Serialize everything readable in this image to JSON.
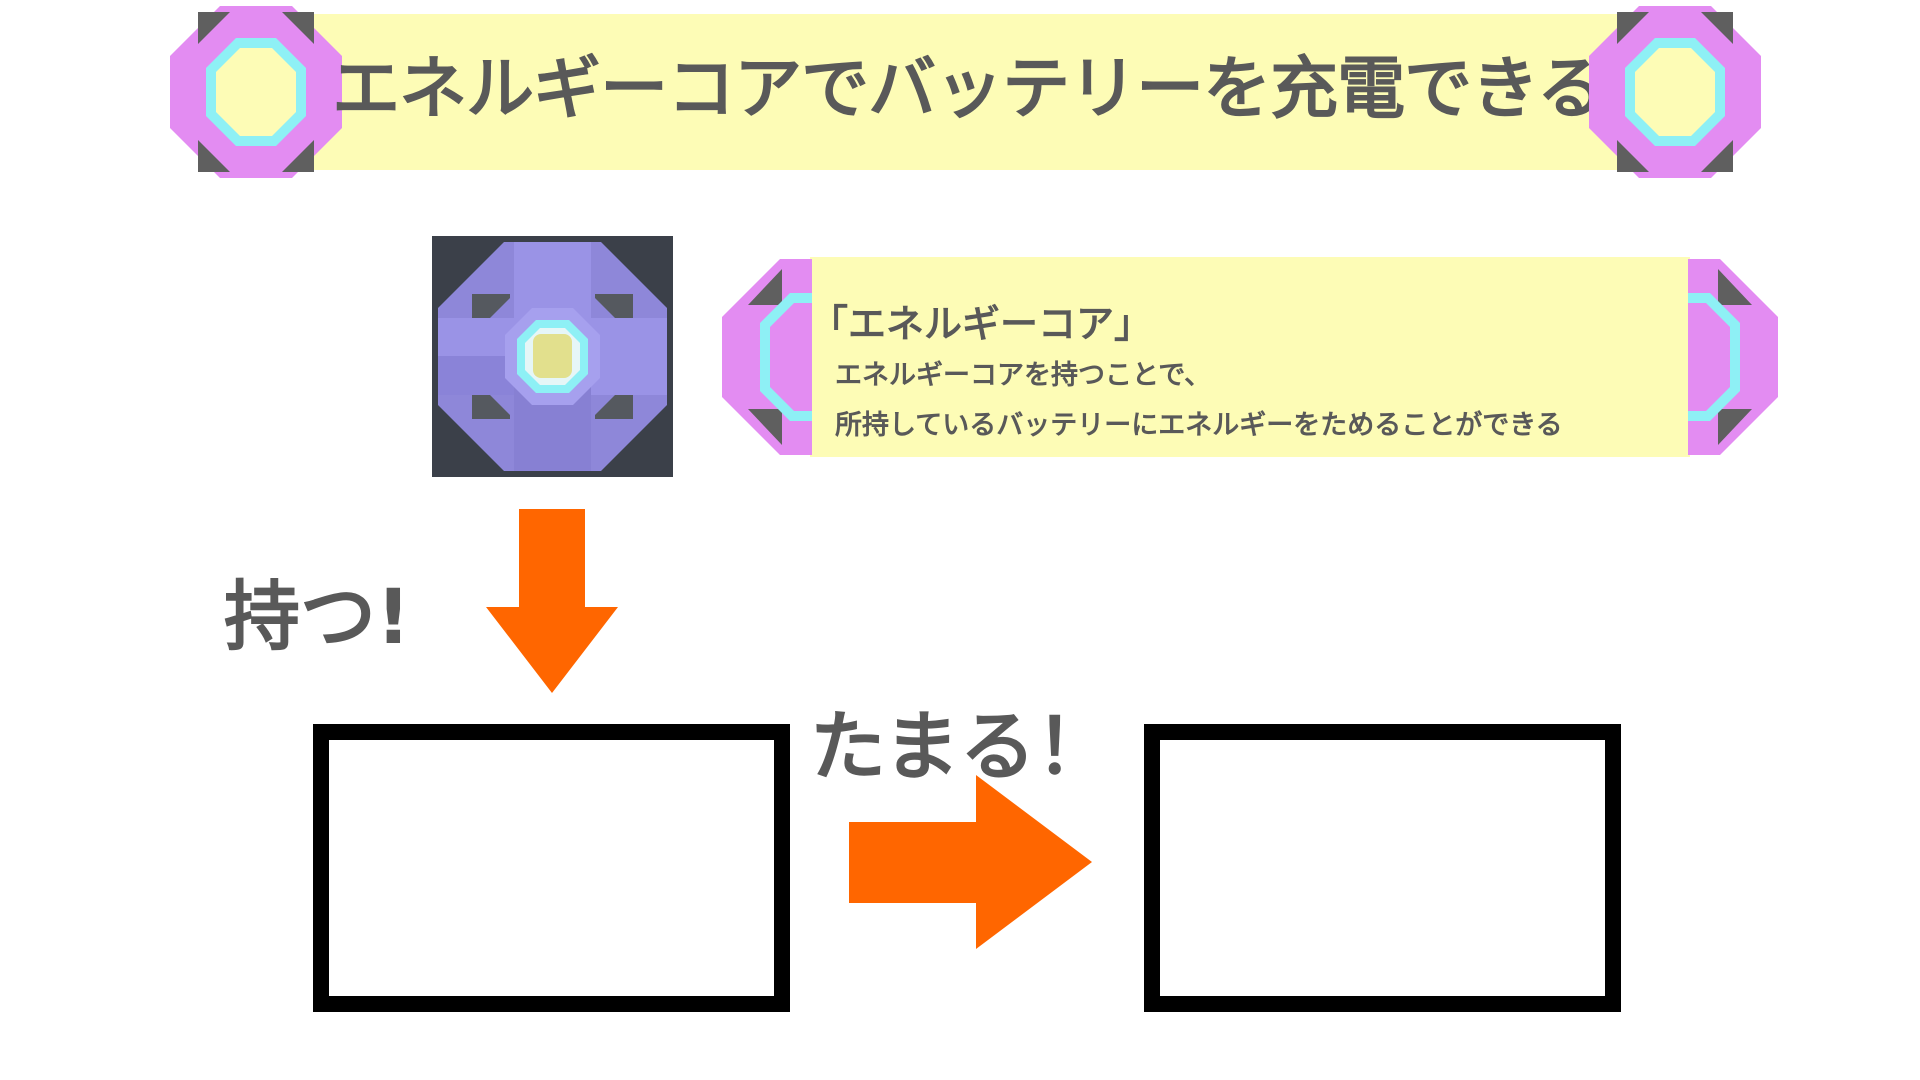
{
  "title_banner": {
    "text": "エネルギーコアでバッテリーを充電できる"
  },
  "info_banner": {
    "title": "「エネルギーコア」",
    "line1": "エネルギーコアを持つことで、",
    "line2": "所持しているバッテリーにエネルギーをためることができる"
  },
  "labels": {
    "hold": "持つ!",
    "charge": "たまる！"
  },
  "icons": {
    "title_left": "octagon-emblem-icon",
    "title_right": "octagon-emblem-icon",
    "core": "energy-core-icon",
    "arrow_down": "down-arrow-icon",
    "arrow_right": "right-arrow-icon"
  },
  "colors": {
    "banner_fill": "#fdfcb6",
    "text": "#595959",
    "arrow": "#ff6600",
    "emblem_pink": "#e38cf2",
    "emblem_cyan": "#8ef0f5",
    "core_purple": "#9a93e6",
    "core_bg": "#3b4049"
  }
}
